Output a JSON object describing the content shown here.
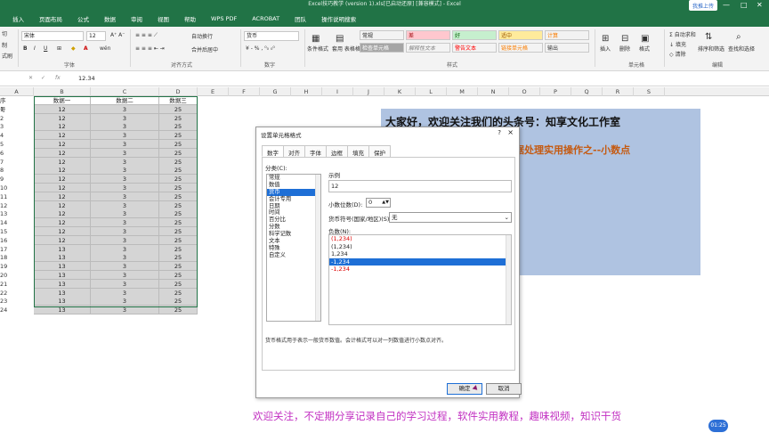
{
  "window": {
    "title": "Excel技巧教学 (version 1).xls[已启动还原] [兼容模式] - Excel",
    "share_label": "我推上传",
    "tabs": [
      "插入",
      "页面布局",
      "公式",
      "数据",
      "审阅",
      "视图",
      "帮助",
      "WPS PDF",
      "ACROBAT",
      "团队",
      "操作说明搜索"
    ]
  },
  "ribbon": {
    "clipboard_items": [
      "切",
      "制",
      "式刷"
    ],
    "font_name": "宋体",
    "font_size": "12",
    "wrap_text": "自动换行",
    "merge_center": "合并后居中",
    "number_format": "货币",
    "group_labels": {
      "font": "字体",
      "alignment": "对齐方式",
      "number": "数字",
      "styles": "样式",
      "cells": "单元格",
      "editing": "编辑"
    },
    "cond_format": "条件格式",
    "table_format": "套用\n表格格式",
    "styles": [
      {
        "label": "常规",
        "bg": "#ffffff",
        "fg": "#000000"
      },
      {
        "label": "差",
        "bg": "#ffc7ce",
        "fg": "#9c0006"
      },
      {
        "label": "好",
        "bg": "#c6efce",
        "fg": "#006100"
      },
      {
        "label": "适中",
        "bg": "#ffeb9c",
        "fg": "#9c5700"
      },
      {
        "label": "计算",
        "bg": "#f2f2f2",
        "fg": "#fa7d00"
      },
      {
        "label": "检查单元格",
        "bg": "#a5a5a5",
        "fg": "#ffffff"
      },
      {
        "label": "解释性文本",
        "bg": "#ffffff",
        "fg": "#7f7f7f"
      },
      {
        "label": "警告文本",
        "bg": "#ffffff",
        "fg": "#ff0000"
      },
      {
        "label": "链接单元格",
        "bg": "#ffffff",
        "fg": "#fa7d00"
      },
      {
        "label": "输出",
        "bg": "#f2f2f2",
        "fg": "#3f3f3f"
      }
    ],
    "insert": "插入",
    "delete": "删除",
    "format": "格式",
    "autosum": "自动求和",
    "fill": "填充",
    "clear": "清除",
    "sort_filter": "排序和筛选",
    "find_select": "查找和选择"
  },
  "formula_bar": {
    "value": "12.34"
  },
  "columns": [
    "A",
    "B",
    "C",
    "D",
    "E",
    "F",
    "G",
    "H",
    "I",
    "J",
    "K",
    "L",
    "M",
    "N",
    "O",
    "P",
    "Q",
    "R",
    "S"
  ],
  "sheet": {
    "header": {
      "num": "序号",
      "c1": "数据一",
      "c2": "数据二",
      "c3": "数据三"
    },
    "rows": [
      [
        "1",
        "12",
        "3",
        "25"
      ],
      [
        "2",
        "12",
        "3",
        "25"
      ],
      [
        "3",
        "12",
        "3",
        "25"
      ],
      [
        "4",
        "12",
        "3",
        "25"
      ],
      [
        "5",
        "12",
        "3",
        "25"
      ],
      [
        "6",
        "12",
        "3",
        "25"
      ],
      [
        "7",
        "12",
        "3",
        "25"
      ],
      [
        "8",
        "12",
        "3",
        "25"
      ],
      [
        "9",
        "12",
        "3",
        "25"
      ],
      [
        "10",
        "12",
        "3",
        "25"
      ],
      [
        "11",
        "12",
        "3",
        "25"
      ],
      [
        "12",
        "12",
        "3",
        "25"
      ],
      [
        "13",
        "12",
        "3",
        "25"
      ],
      [
        "14",
        "12",
        "3",
        "25"
      ],
      [
        "15",
        "12",
        "3",
        "25"
      ],
      [
        "16",
        "12",
        "3",
        "25"
      ],
      [
        "17",
        "13",
        "3",
        "25"
      ],
      [
        "18",
        "13",
        "3",
        "25"
      ],
      [
        "19",
        "13",
        "3",
        "25"
      ],
      [
        "20",
        "13",
        "3",
        "25"
      ],
      [
        "21",
        "13",
        "3",
        "25"
      ],
      [
        "22",
        "13",
        "3",
        "25"
      ],
      [
        "23",
        "13",
        "3",
        "25"
      ],
      [
        "24",
        "13",
        "3",
        "25"
      ]
    ]
  },
  "banner": {
    "line1": "大家好，欢迎关注我们的头条号：知享文化工作室",
    "line2": "据处理实用操作之--小数点"
  },
  "dialog": {
    "title": "设置单元格格式",
    "help": "?",
    "close": "×",
    "tabs": [
      "数字",
      "对齐",
      "字体",
      "边框",
      "填充",
      "保护"
    ],
    "category_label": "分类(C):",
    "categories": [
      "常规",
      "数值",
      "货币",
      "会计专用",
      "日期",
      "时间",
      "百分比",
      "分数",
      "科学记数",
      "文本",
      "特殊",
      "自定义"
    ],
    "selected_category": "货币",
    "sample_label": "示例",
    "sample_value": "12",
    "decimal_label": "小数位数(D):",
    "decimal_value": "0",
    "symbol_label": "货币符号(国家/地区)(S):",
    "symbol_value": "无",
    "negative_label": "负数(N):",
    "negatives": [
      "(1,234)",
      "(1,234)",
      "1,234",
      "-1,234",
      "-1,234"
    ],
    "description": "货币格式用于表示一般货币数值。会计格式可以对一列数值进行小数点对齐。",
    "ok": "确定",
    "cancel": "取消"
  },
  "footer": "欢迎关注，不定期分享记录自己的学习过程，软件实用教程，趣味视频，知识干货",
  "badge": "01:25"
}
